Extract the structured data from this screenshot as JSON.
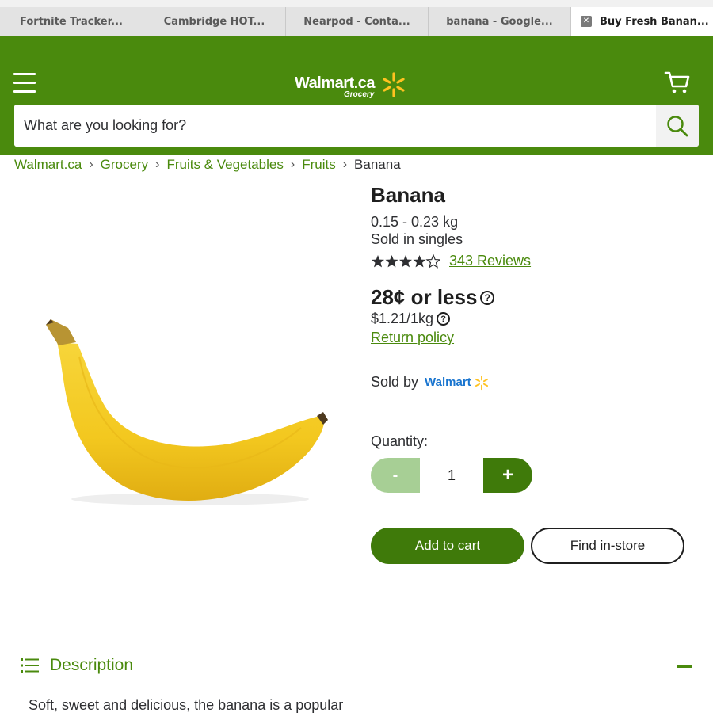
{
  "browser": {
    "tabs": [
      {
        "label": "Fortnite Tracker..."
      },
      {
        "label": "Cambridge HOT..."
      },
      {
        "label": "Nearpod - Conta..."
      },
      {
        "label": "banana - Google..."
      },
      {
        "label": "Buy Fresh Banan..."
      }
    ],
    "close_glyph": "✕"
  },
  "header": {
    "logo_text": "Walmart.ca",
    "logo_sub": "Grocery",
    "search": {
      "placeholder": "What are you looking for?"
    },
    "icons": {
      "menu": "hamburger-menu-icon",
      "cart": "cart-icon",
      "search": "search-icon"
    }
  },
  "breadcrumb": {
    "items": [
      "Walmart.ca",
      "Grocery",
      "Fruits & Vegetables",
      "Fruits"
    ],
    "current": "Banana",
    "separator": "›"
  },
  "product": {
    "title": "Banana",
    "weight": "0.15 - 0.23 kg",
    "sold_in": "Sold in singles",
    "rating": 4.5,
    "reviews": "343 Reviews",
    "price": "28¢ or less",
    "unit_price": "$1.21/1kg",
    "help_glyph": "?",
    "return_policy": "Return policy",
    "sold_by_label": "Sold by",
    "seller": "Walmart",
    "quantity_label": "Quantity:",
    "quantity": "1",
    "minus": "-",
    "plus": "+",
    "add_to_cart": "Add to cart",
    "find_in_store": "Find in-store"
  },
  "description": {
    "title": "Description",
    "text": "Soft, sweet and delicious, the banana is a popular"
  },
  "colors": {
    "brand_green": "#4a8a0d",
    "button_green": "#3f7a0a",
    "disabled_green": "#a7cf95",
    "spark_yellow": "#ffc220",
    "seller_blue": "#1a75cf"
  }
}
